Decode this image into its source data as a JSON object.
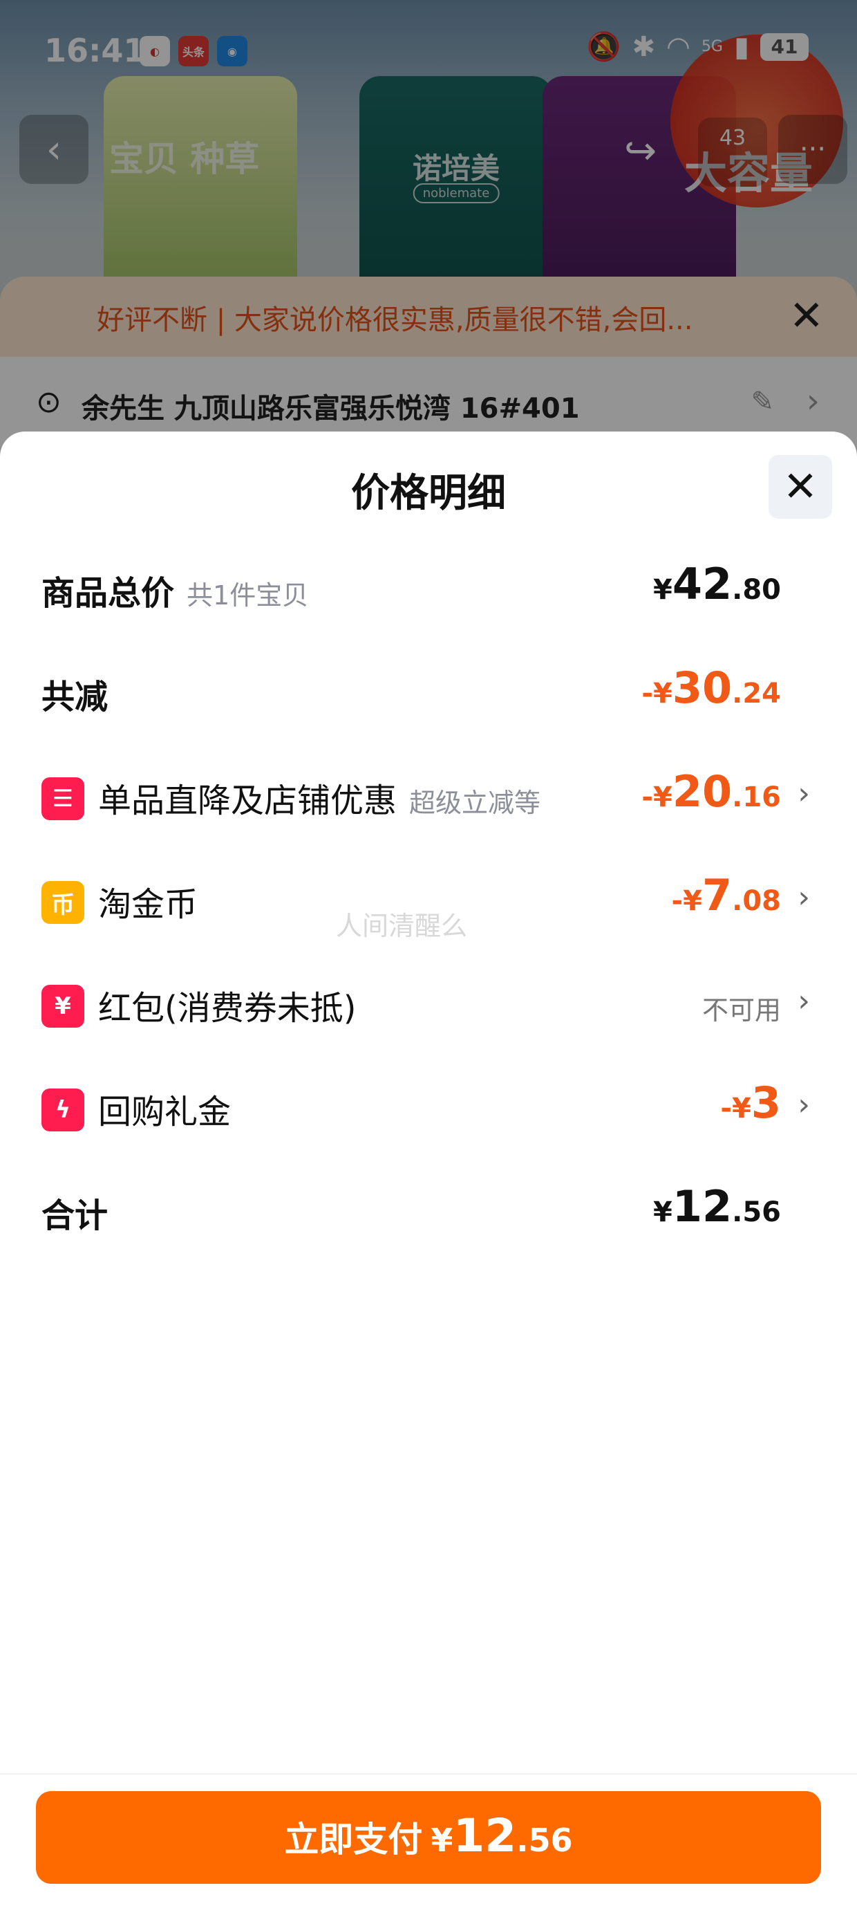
{
  "status_bar": {
    "time": "16:41",
    "app_icons": [
      "手机管家",
      "头条",
      "浏览器"
    ],
    "signal": "5G",
    "battery": "41"
  },
  "background_page": {
    "nav_tabs": "宝贝  种草",
    "cart_count": "43",
    "product_brand": "诺培美",
    "product_brand_en": "noblemate",
    "promo_badge": "大容量",
    "tip_bar": "好评不断 | 大家说价格很实惠,质量很不错,会回...",
    "address": "余先生 九顶山路乐富强乐悦湾 16#401"
  },
  "sheet": {
    "title": "价格明细",
    "rows": [
      {
        "label": "商品总价",
        "sub": "共1件宝贝",
        "currency": "¥",
        "int": "42",
        "dec": ".80"
      },
      {
        "label": "共减",
        "sign": "-",
        "currency": "¥",
        "int": "30",
        "dec": ".24"
      },
      {
        "label": "单品直降及店铺优惠",
        "sub": "超级立减等",
        "sign": "-",
        "currency": "¥",
        "int": "20",
        "dec": ".16"
      },
      {
        "label": "淘金币",
        "sign": "-",
        "currency": "¥",
        "int": "7",
        "dec": ".08"
      },
      {
        "label": "红包(消费券未抵)",
        "status": "不可用"
      },
      {
        "label": "回购礼金",
        "sign": "-",
        "currency": "¥",
        "int": "3",
        "dec": ""
      },
      {
        "label": "合计",
        "currency": "¥",
        "int": "12",
        "dec": ".56"
      }
    ],
    "watermark": "人间清醒么"
  },
  "pay_button": {
    "label": "立即支付",
    "currency": "¥",
    "int": "12",
    "dec": ".56"
  },
  "colors": {
    "accent_orange": "#ff6a00",
    "discount_orange": "#f05a16",
    "icon_red": "#ff1d4f",
    "icon_gold": "#ffb300"
  }
}
